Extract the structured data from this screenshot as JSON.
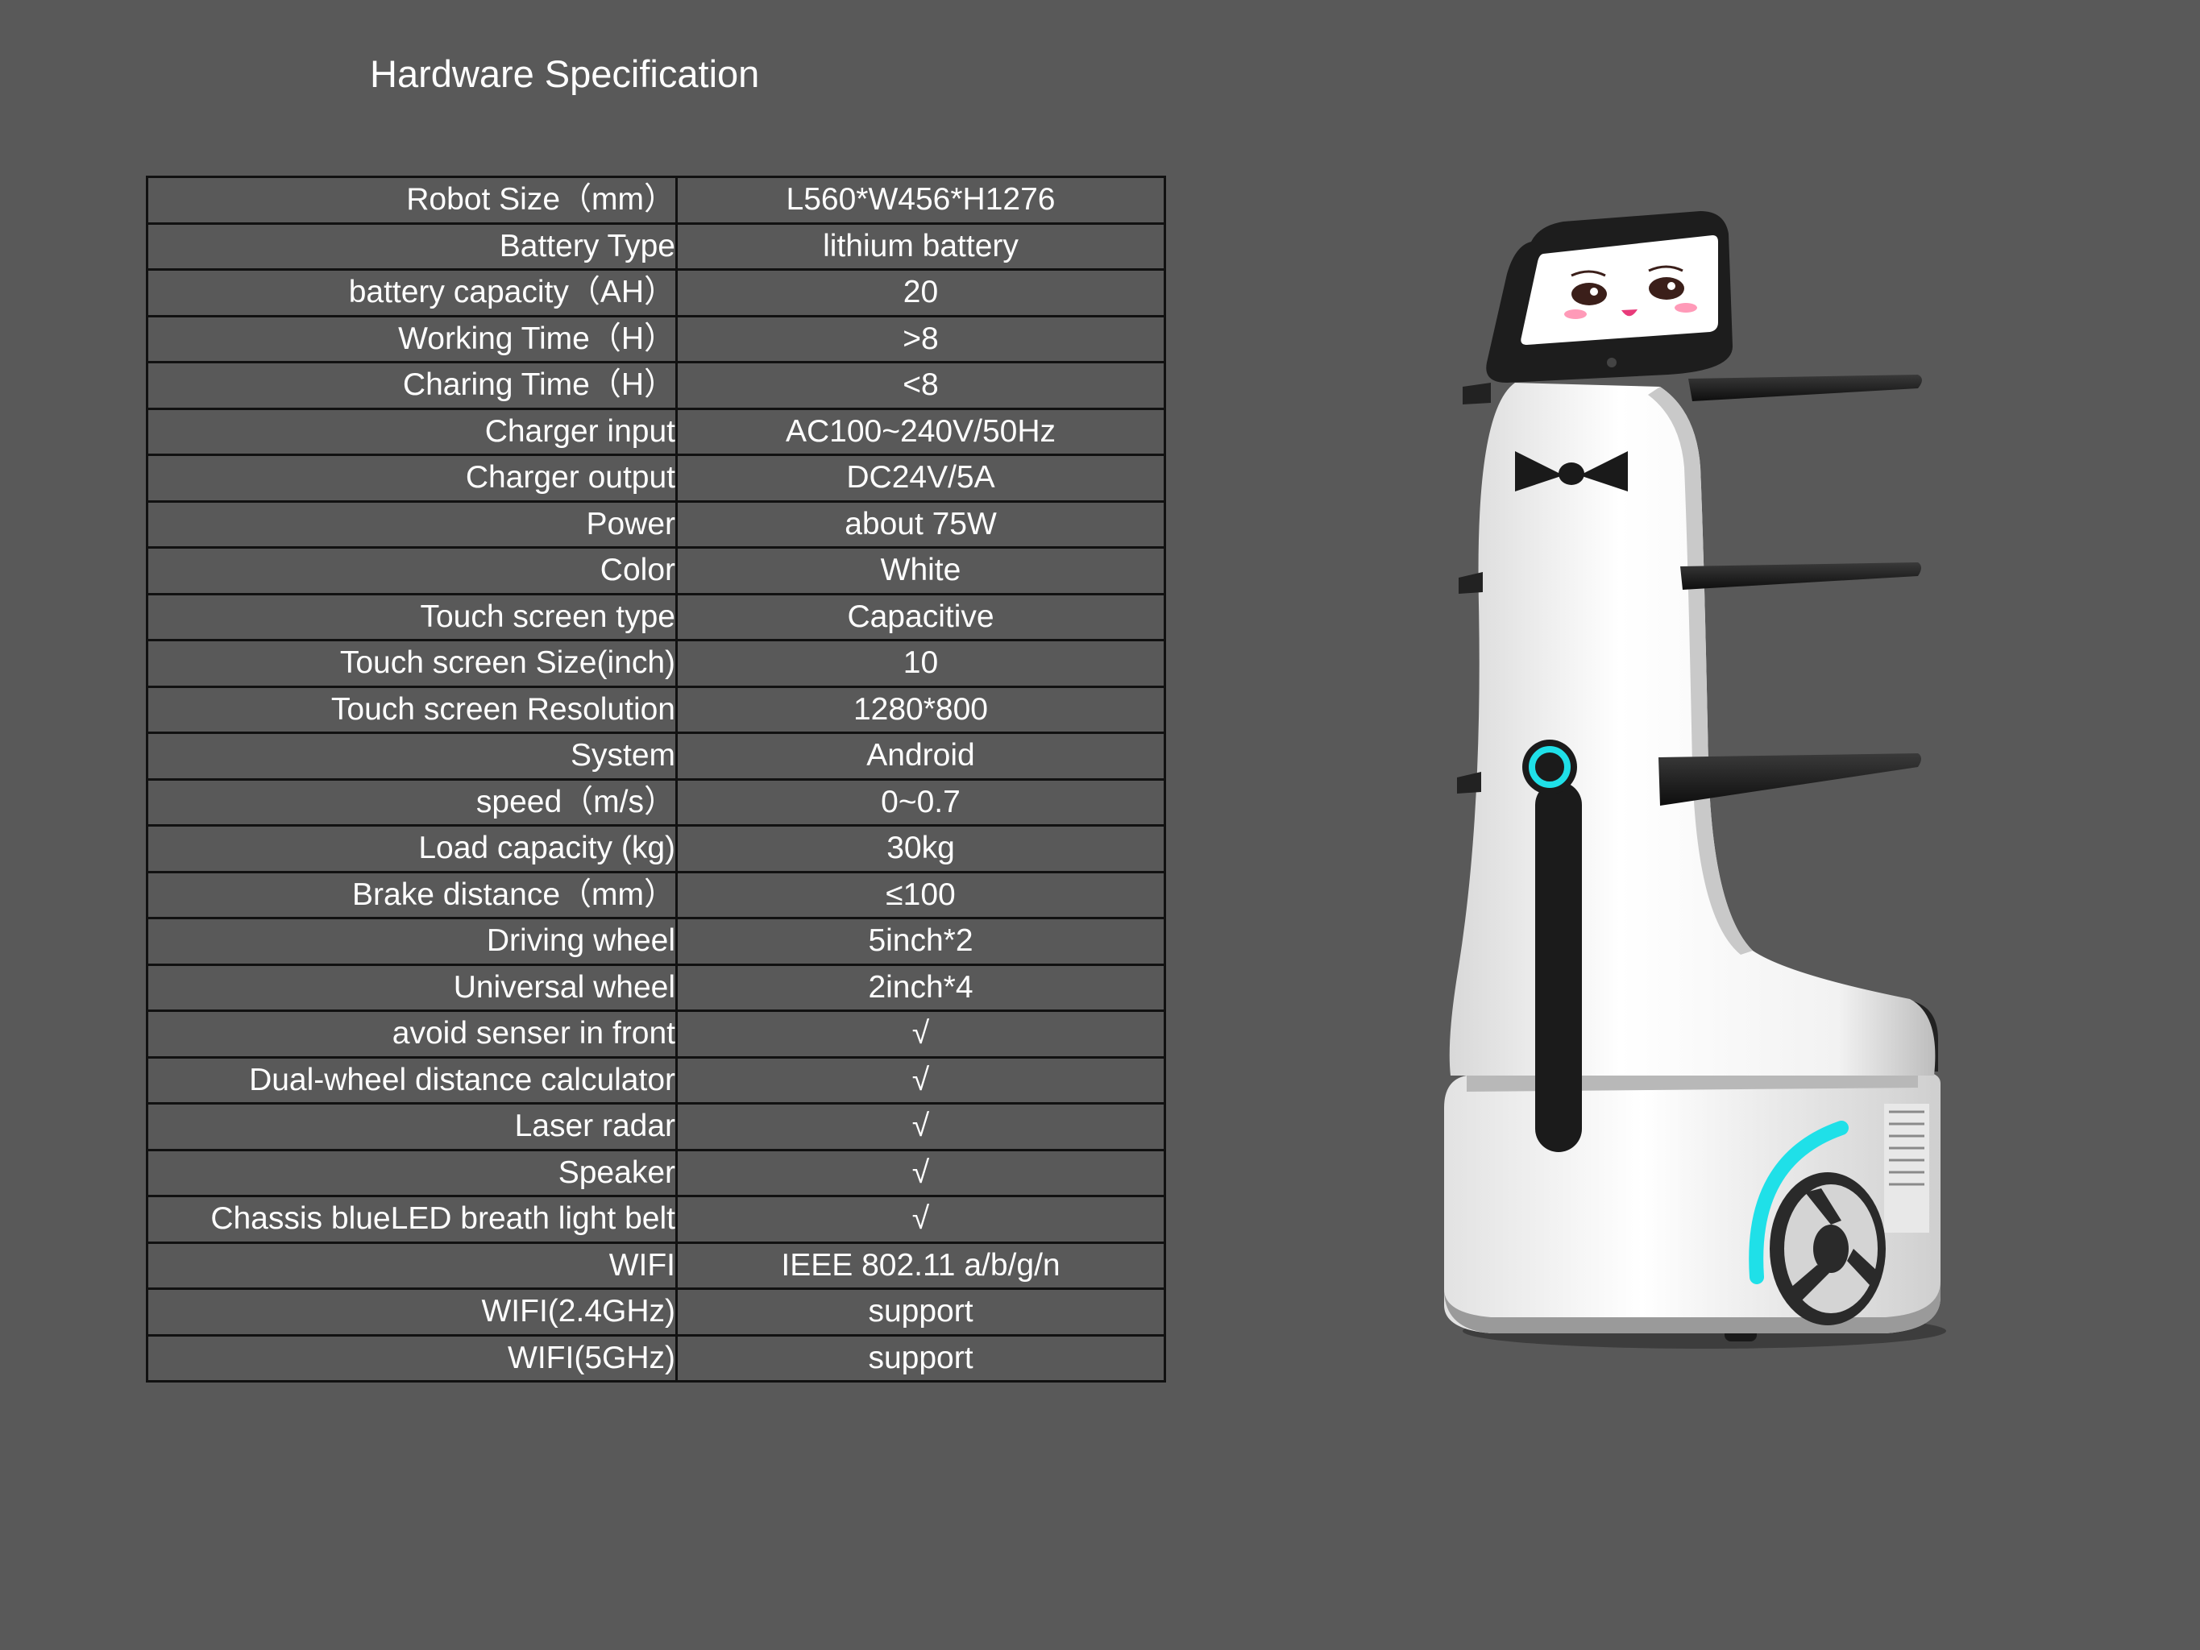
{
  "page": {
    "title": "Hardware Specification"
  },
  "specs": [
    {
      "label": "Robot Size（mm）",
      "value": "L560*W456*H1276"
    },
    {
      "label": "Battery Type",
      "value": "lithium battery"
    },
    {
      "label": "battery capacity（AH）",
      "value": "20"
    },
    {
      "label": "Working Time（H）",
      "value": ">8"
    },
    {
      "label": "Charing Time（H）",
      "value": "<8"
    },
    {
      "label": "Charger input",
      "value": "AC100~240V/50Hz"
    },
    {
      "label": "Charger output",
      "value": "DC24V/5A"
    },
    {
      "label": "Power",
      "value": "about 75W"
    },
    {
      "label": "Color",
      "value": "White"
    },
    {
      "label": "Touch screen type",
      "value": "Capacitive"
    },
    {
      "label": "Touch screen Size(inch)",
      "value": "10"
    },
    {
      "label": "Touch screen Resolution",
      "value": "1280*800"
    },
    {
      "label": "System",
      "value": "Android"
    },
    {
      "label": "speed（m/s）",
      "value": "0~0.7"
    },
    {
      "label": "Load capacity (kg)",
      "value": "30kg"
    },
    {
      "label": "Brake distance（mm）",
      "value": "≤100"
    },
    {
      "label": "Driving wheel",
      "value": "5inch*2"
    },
    {
      "label": "Universal wheel",
      "value": "2inch*4"
    },
    {
      "label": "avoid senser in front",
      "value": "√"
    },
    {
      "label": "Dual-wheel distance calculator",
      "value": "√"
    },
    {
      "label": "Laser radar",
      "value": "√"
    },
    {
      "label": "Speaker",
      "value": "√"
    },
    {
      "label": "Chassis blueLED breath light belt",
      "value": "√"
    },
    {
      "label": "WIFI",
      "value": "IEEE 802.11 a/b/g/n"
    },
    {
      "label": "WIFI(2.4GHz)",
      "value": "support"
    },
    {
      "label": "WIFI(5GHz)",
      "value": "support"
    }
  ],
  "robot": {
    "body_color": "#ffffff",
    "accent_color": "#1fe0e8",
    "dark_color": "#1a1a1a"
  }
}
